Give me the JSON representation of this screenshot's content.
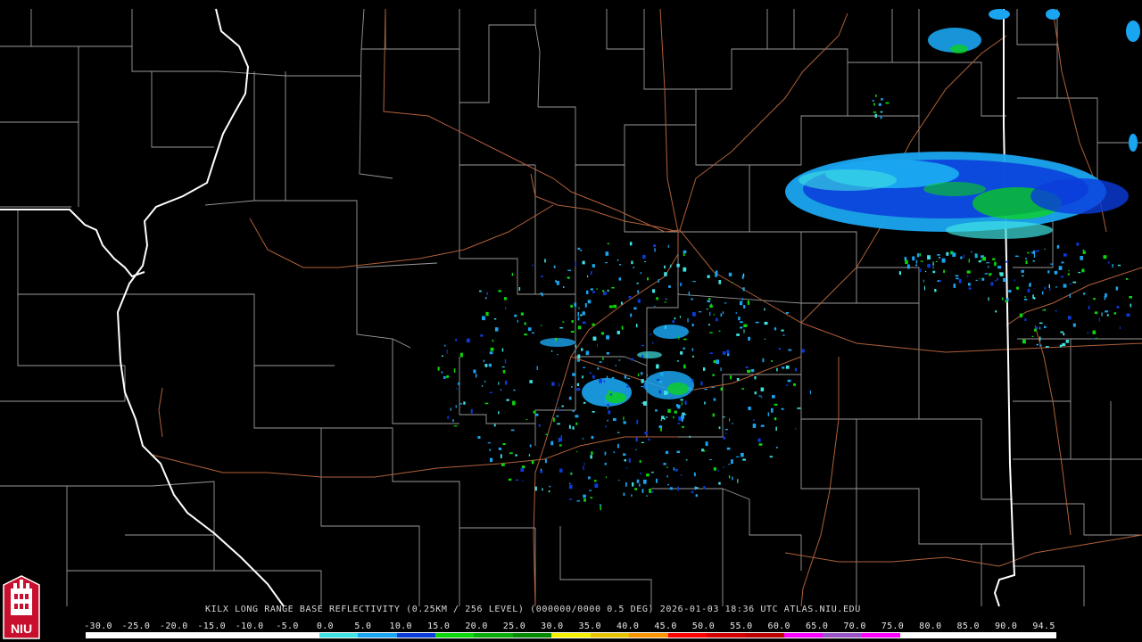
{
  "radar": {
    "station": "KILX",
    "caption": "KILX LONG RANGE BASE REFLECTIVITY (0.25KM / 256 LEVEL) (000000/0000 0.5 DEG) 2026-01-03 18:36 UTC  ATLAS.NIU.EDU",
    "site_location": [
      -89.34,
      40.15
    ]
  },
  "colorbar": {
    "labels": [
      "-30.0",
      "-25.0",
      "-20.0",
      "-15.0",
      "-10.0",
      "-5.0",
      "0.0",
      "5.0",
      "10.0",
      "15.0",
      "20.0",
      "25.0",
      "30.0",
      "35.0",
      "40.0",
      "45.0",
      "50.0",
      "55.0",
      "60.0",
      "65.0",
      "70.0",
      "75.0",
      "80.0",
      "85.0",
      "90.0",
      "94.5"
    ],
    "colors": [
      "#ffffff",
      "#ffffff",
      "#ffffff",
      "#ffffff",
      "#ffffff",
      "#ffffff",
      "#3fe3e3",
      "#1aa5f0",
      "#0a3cdc",
      "#0ad80a",
      "#06ac06",
      "#038a03",
      "#f5f000",
      "#e8c400",
      "#fd9500",
      "#fd0000",
      "#d40000",
      "#bc0000",
      "#f800fd",
      "#9854c6",
      "#ff00ff",
      "#ffffff",
      "#ffffff",
      "#ffffff",
      "#ffffff"
    ],
    "min": -30.0,
    "max": 94.5
  },
  "map_colors": {
    "background": "#000000",
    "county_lines": "#9a9a9a",
    "state_lines": "#ffffff",
    "highways": "#b0603a",
    "echo_light": "#3fe3e3",
    "echo_mid": "#1aa5f0",
    "echo_heavy": "#0a3cdc",
    "echo_green": "#0ad80a"
  },
  "logo": {
    "text": "NIU",
    "colors": [
      "#c8102e",
      "#ffffff"
    ]
  }
}
